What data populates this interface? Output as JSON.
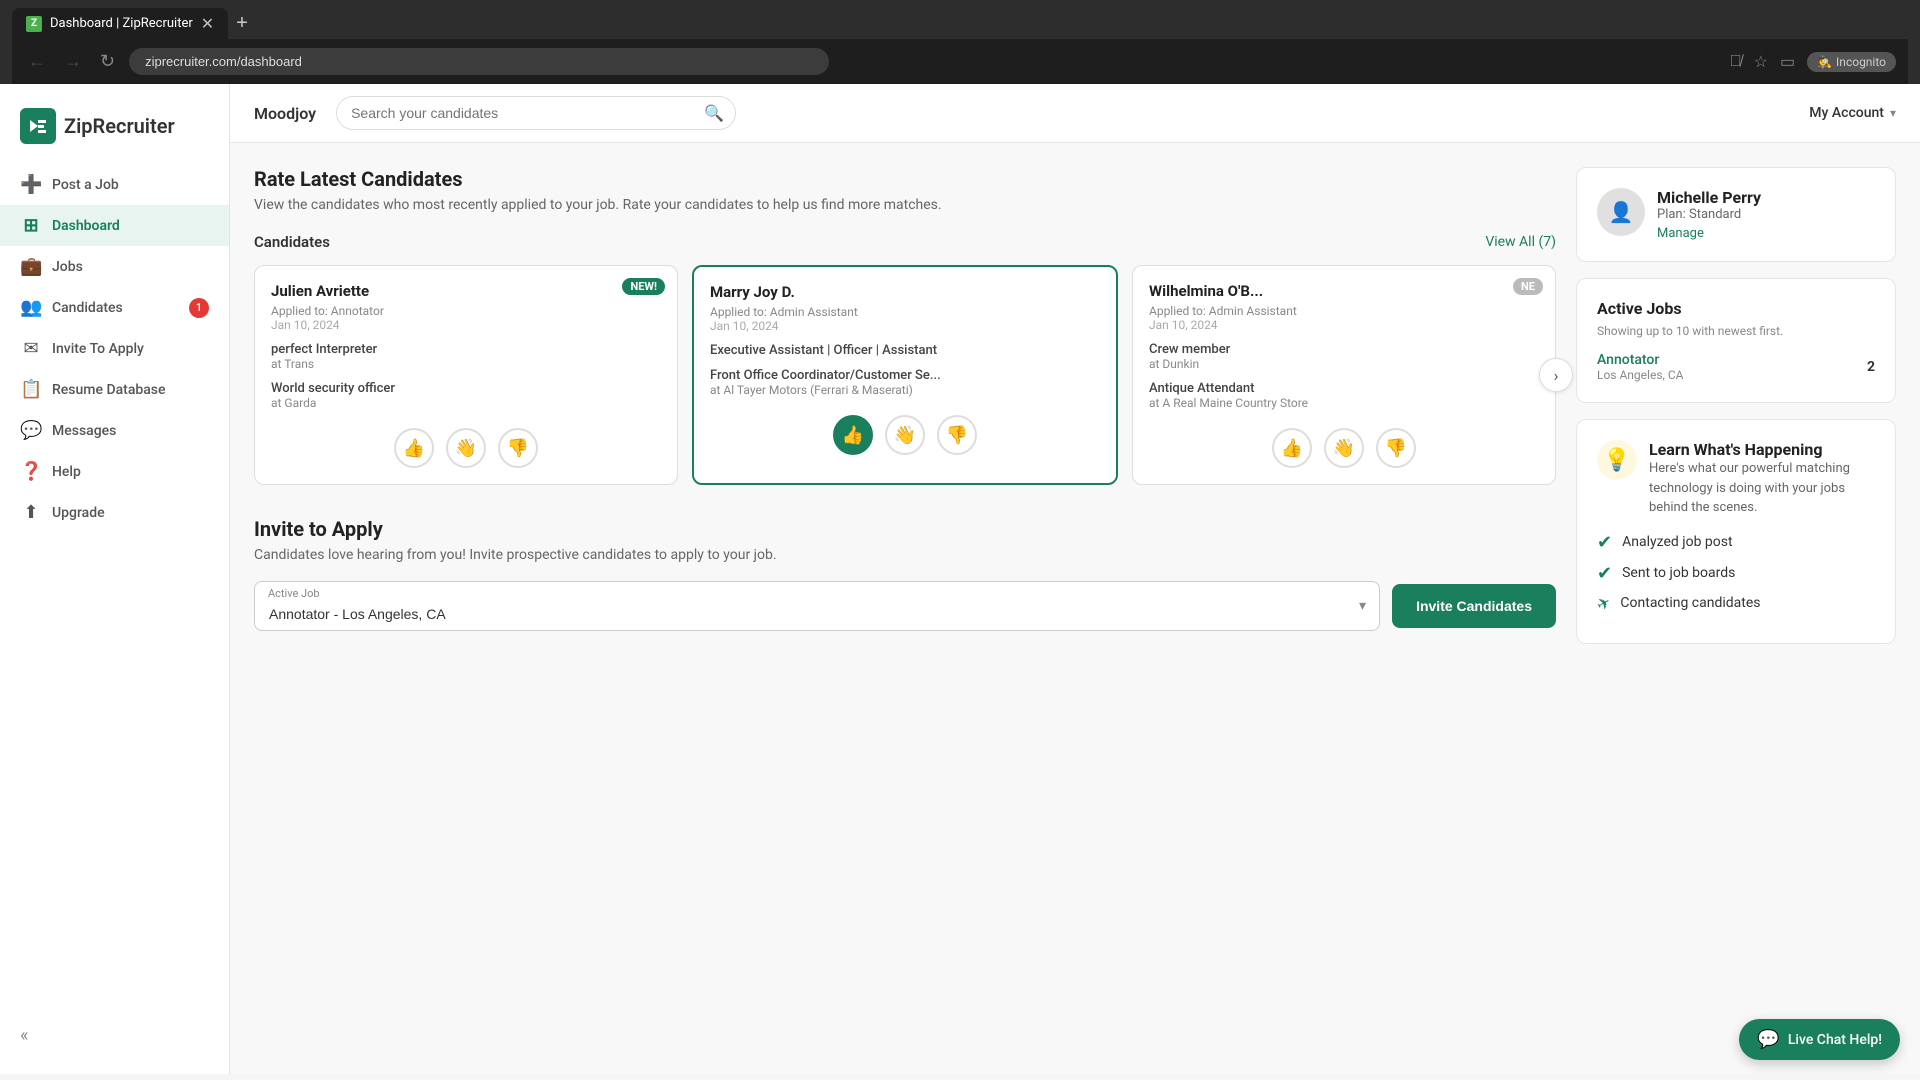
{
  "browser": {
    "tab_title": "Dashboard | ZipRecruiter",
    "url": "ziprecruiter.com/dashboard",
    "new_tab_label": "+",
    "incognito_label": "Incognito"
  },
  "sidebar": {
    "logo_text": "ZipRecruiter",
    "items": [
      {
        "id": "post-a-job",
        "label": "Post a Job",
        "icon": "➕",
        "active": false
      },
      {
        "id": "dashboard",
        "label": "Dashboard",
        "icon": "⊞",
        "active": true
      },
      {
        "id": "jobs",
        "label": "Jobs",
        "icon": "💼",
        "active": false
      },
      {
        "id": "candidates",
        "label": "Candidates",
        "icon": "👥",
        "active": false,
        "badge": "1"
      },
      {
        "id": "invite-to-apply",
        "label": "Invite To Apply",
        "icon": "✉",
        "active": false
      },
      {
        "id": "resume-database",
        "label": "Resume Database",
        "icon": "📋",
        "active": false
      },
      {
        "id": "messages",
        "label": "Messages",
        "icon": "💬",
        "active": false
      },
      {
        "id": "help",
        "label": "Help",
        "icon": "❓",
        "active": false
      },
      {
        "id": "upgrade",
        "label": "Upgrade",
        "icon": "⬆",
        "active": false
      }
    ]
  },
  "topbar": {
    "company_name": "Moodjoy",
    "search_placeholder": "Search your candidates",
    "my_account_label": "My Account"
  },
  "rate_candidates": {
    "section_title": "Rate Latest Candidates",
    "section_subtitle": "View the candidates who most recently applied to your job. Rate your candidates to help us find more matches.",
    "candidates_label": "Candidates",
    "view_all_label": "View All (7)",
    "cards": [
      {
        "name": "Julien Avriette",
        "badge": "NEW!",
        "badge_type": "green",
        "applied_to": "Applied to: Annotator",
        "applied_date": "Jan 10, 2024",
        "job1_title": "perfect Interpreter",
        "job1_company": "at Trans",
        "job2_title": "World security officer",
        "job2_company": "at Garda",
        "active_action": "none"
      },
      {
        "name": "Marry Joy D.",
        "badge": "",
        "badge_type": "",
        "applied_to": "Applied to: Admin Assistant",
        "applied_date": "Jan 10, 2024",
        "job1_title": "Executive Assistant | Officer | Assistant",
        "job1_company": "",
        "job2_title": "Front Office Coordinator/Customer Se...",
        "job2_company": "at Al Tayer Motors (Ferrari & Maserati)",
        "active_action": "like"
      },
      {
        "name": "Wilhelmina O'B...",
        "badge": "NE",
        "badge_type": "grey",
        "applied_to": "Applied to: Admin Assistant",
        "applied_date": "Jan 10, 2024",
        "job1_title": "Crew member",
        "job1_company": "at Dunkin",
        "job2_title": "Antique Attendant",
        "job2_company": "at A Real Maine Country Store",
        "active_action": "none"
      }
    ]
  },
  "invite_to_apply": {
    "section_title": "Invite to Apply",
    "section_subtitle": "Candidates love hearing from you! Invite prospective candidates to apply to your job.",
    "active_job_label": "Active Job",
    "active_job_value": "Annotator - Los Angeles, CA",
    "invite_btn_label": "Invite Candidates"
  },
  "user_card": {
    "name": "Michelle Perry",
    "plan_label": "Plan: Standard",
    "manage_label": "Manage"
  },
  "active_jobs": {
    "title": "Active Jobs",
    "subtitle": "Showing up to 10 with newest first.",
    "items": [
      {
        "name": "Annotator",
        "location": "Los Angeles, CA",
        "count": "2"
      }
    ]
  },
  "learn_card": {
    "title": "Learn What's Happening",
    "description": "Here's what our powerful matching technology is doing with your jobs behind the scenes.",
    "items": [
      {
        "label": "Analyzed job post",
        "icon": "check"
      },
      {
        "label": "Sent to job boards",
        "icon": "check"
      },
      {
        "label": "Contacting candidates",
        "icon": "send"
      }
    ]
  },
  "live_chat": {
    "label": "Live Chat Help!"
  }
}
